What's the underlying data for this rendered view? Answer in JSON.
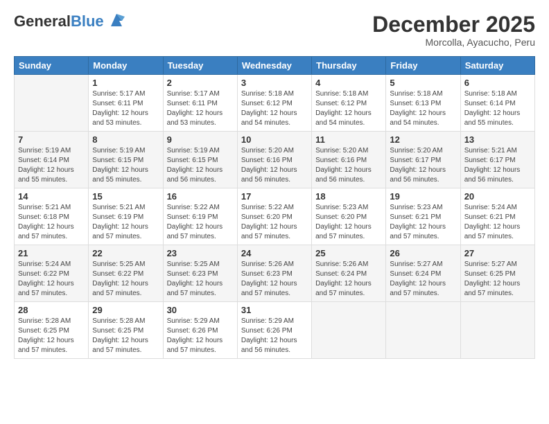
{
  "header": {
    "logo_general": "General",
    "logo_blue": "Blue",
    "month": "December 2025",
    "location": "Morcolla, Ayacucho, Peru"
  },
  "weekdays": [
    "Sunday",
    "Monday",
    "Tuesday",
    "Wednesday",
    "Thursday",
    "Friday",
    "Saturday"
  ],
  "weeks": [
    [
      {
        "day": "",
        "info": ""
      },
      {
        "day": "1",
        "info": "Sunrise: 5:17 AM\nSunset: 6:11 PM\nDaylight: 12 hours\nand 53 minutes."
      },
      {
        "day": "2",
        "info": "Sunrise: 5:17 AM\nSunset: 6:11 PM\nDaylight: 12 hours\nand 53 minutes."
      },
      {
        "day": "3",
        "info": "Sunrise: 5:18 AM\nSunset: 6:12 PM\nDaylight: 12 hours\nand 54 minutes."
      },
      {
        "day": "4",
        "info": "Sunrise: 5:18 AM\nSunset: 6:12 PM\nDaylight: 12 hours\nand 54 minutes."
      },
      {
        "day": "5",
        "info": "Sunrise: 5:18 AM\nSunset: 6:13 PM\nDaylight: 12 hours\nand 54 minutes."
      },
      {
        "day": "6",
        "info": "Sunrise: 5:18 AM\nSunset: 6:14 PM\nDaylight: 12 hours\nand 55 minutes."
      }
    ],
    [
      {
        "day": "7",
        "info": "Sunrise: 5:19 AM\nSunset: 6:14 PM\nDaylight: 12 hours\nand 55 minutes."
      },
      {
        "day": "8",
        "info": "Sunrise: 5:19 AM\nSunset: 6:15 PM\nDaylight: 12 hours\nand 55 minutes."
      },
      {
        "day": "9",
        "info": "Sunrise: 5:19 AM\nSunset: 6:15 PM\nDaylight: 12 hours\nand 56 minutes."
      },
      {
        "day": "10",
        "info": "Sunrise: 5:20 AM\nSunset: 6:16 PM\nDaylight: 12 hours\nand 56 minutes."
      },
      {
        "day": "11",
        "info": "Sunrise: 5:20 AM\nSunset: 6:16 PM\nDaylight: 12 hours\nand 56 minutes."
      },
      {
        "day": "12",
        "info": "Sunrise: 5:20 AM\nSunset: 6:17 PM\nDaylight: 12 hours\nand 56 minutes."
      },
      {
        "day": "13",
        "info": "Sunrise: 5:21 AM\nSunset: 6:17 PM\nDaylight: 12 hours\nand 56 minutes."
      }
    ],
    [
      {
        "day": "14",
        "info": "Sunrise: 5:21 AM\nSunset: 6:18 PM\nDaylight: 12 hours\nand 57 minutes."
      },
      {
        "day": "15",
        "info": "Sunrise: 5:21 AM\nSunset: 6:19 PM\nDaylight: 12 hours\nand 57 minutes."
      },
      {
        "day": "16",
        "info": "Sunrise: 5:22 AM\nSunset: 6:19 PM\nDaylight: 12 hours\nand 57 minutes."
      },
      {
        "day": "17",
        "info": "Sunrise: 5:22 AM\nSunset: 6:20 PM\nDaylight: 12 hours\nand 57 minutes."
      },
      {
        "day": "18",
        "info": "Sunrise: 5:23 AM\nSunset: 6:20 PM\nDaylight: 12 hours\nand 57 minutes."
      },
      {
        "day": "19",
        "info": "Sunrise: 5:23 AM\nSunset: 6:21 PM\nDaylight: 12 hours\nand 57 minutes."
      },
      {
        "day": "20",
        "info": "Sunrise: 5:24 AM\nSunset: 6:21 PM\nDaylight: 12 hours\nand 57 minutes."
      }
    ],
    [
      {
        "day": "21",
        "info": "Sunrise: 5:24 AM\nSunset: 6:22 PM\nDaylight: 12 hours\nand 57 minutes."
      },
      {
        "day": "22",
        "info": "Sunrise: 5:25 AM\nSunset: 6:22 PM\nDaylight: 12 hours\nand 57 minutes."
      },
      {
        "day": "23",
        "info": "Sunrise: 5:25 AM\nSunset: 6:23 PM\nDaylight: 12 hours\nand 57 minutes."
      },
      {
        "day": "24",
        "info": "Sunrise: 5:26 AM\nSunset: 6:23 PM\nDaylight: 12 hours\nand 57 minutes."
      },
      {
        "day": "25",
        "info": "Sunrise: 5:26 AM\nSunset: 6:24 PM\nDaylight: 12 hours\nand 57 minutes."
      },
      {
        "day": "26",
        "info": "Sunrise: 5:27 AM\nSunset: 6:24 PM\nDaylight: 12 hours\nand 57 minutes."
      },
      {
        "day": "27",
        "info": "Sunrise: 5:27 AM\nSunset: 6:25 PM\nDaylight: 12 hours\nand 57 minutes."
      }
    ],
    [
      {
        "day": "28",
        "info": "Sunrise: 5:28 AM\nSunset: 6:25 PM\nDaylight: 12 hours\nand 57 minutes."
      },
      {
        "day": "29",
        "info": "Sunrise: 5:28 AM\nSunset: 6:25 PM\nDaylight: 12 hours\nand 57 minutes."
      },
      {
        "day": "30",
        "info": "Sunrise: 5:29 AM\nSunset: 6:26 PM\nDaylight: 12 hours\nand 57 minutes."
      },
      {
        "day": "31",
        "info": "Sunrise: 5:29 AM\nSunset: 6:26 PM\nDaylight: 12 hours\nand 56 minutes."
      },
      {
        "day": "",
        "info": ""
      },
      {
        "day": "",
        "info": ""
      },
      {
        "day": "",
        "info": ""
      }
    ]
  ]
}
